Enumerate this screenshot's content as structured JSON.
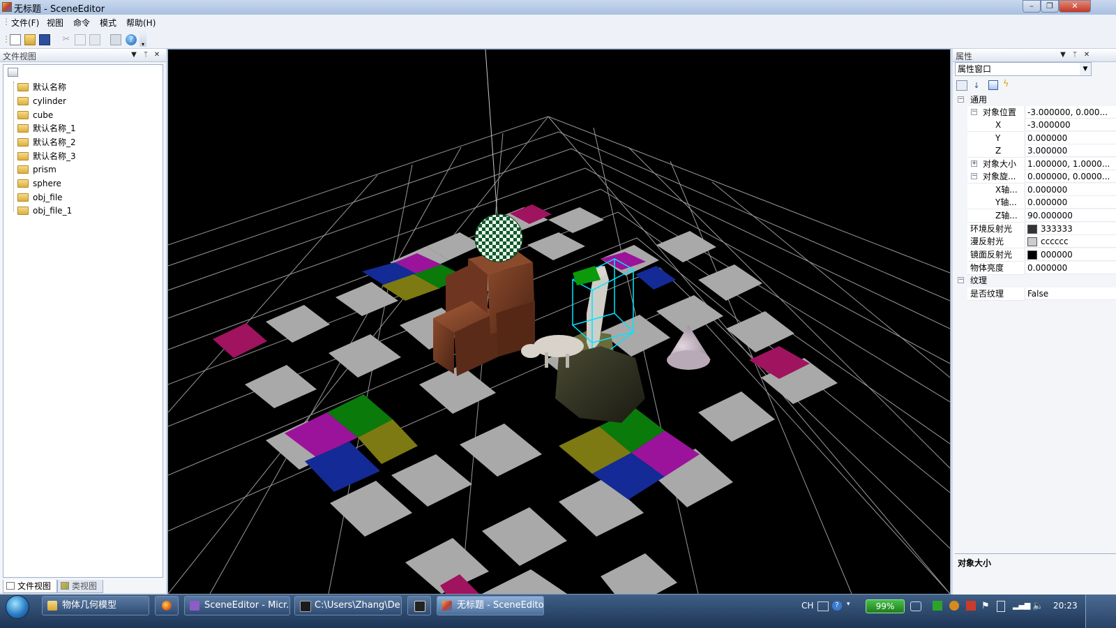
{
  "window": {
    "title": "无标题 - SceneEditor",
    "controls": [
      "minimize",
      "maximize",
      "close"
    ]
  },
  "menu": [
    "文件(F)",
    "视图",
    "命令",
    "模式",
    "帮助(H)"
  ],
  "toolbar_icons": [
    "new-icon",
    "open-icon",
    "save-icon",
    "cut-icon",
    "copy-icon",
    "paste-icon",
    "print-icon",
    "help-icon"
  ],
  "file_view": {
    "title": "文件视图",
    "items": [
      "默认名称",
      "cylinder",
      "cube",
      "默认名称_1",
      "默认名称_2",
      "默认名称_3",
      "prism",
      "sphere",
      "obj_file",
      "obj_file_1"
    ],
    "tabs": [
      "文件视图",
      "类视图"
    ]
  },
  "properties": {
    "title": "属性",
    "selector": "属性窗口",
    "sections": {
      "general": "通用",
      "texture": "纹理"
    },
    "rows": {
      "position": {
        "name": "对象位置",
        "value": "-3.000000, 0.000..."
      },
      "pos_x": {
        "name": "X",
        "value": "-3.000000"
      },
      "pos_y": {
        "name": "Y",
        "value": "0.000000"
      },
      "pos_z": {
        "name": "Z",
        "value": "3.000000"
      },
      "size": {
        "name": "对象大小",
        "value": "1.000000, 1.0000..."
      },
      "rotation": {
        "name": "对象旋...",
        "value": "0.000000, 0.0000..."
      },
      "rot_x": {
        "name": "X轴...",
        "value": "0.000000"
      },
      "rot_y": {
        "name": "Y轴...",
        "value": "0.000000"
      },
      "rot_z": {
        "name": "Z轴...",
        "value": "90.000000"
      },
      "ambient": {
        "name": "环境反射光",
        "value": "333333",
        "color": "#333333"
      },
      "diffuse": {
        "name": "漫反射光",
        "value": "cccccc",
        "color": "#cccccc"
      },
      "specular": {
        "name": "镜面反射光",
        "value": "000000",
        "color": "#000000"
      },
      "shininess": {
        "name": "物体亮度",
        "value": "0.000000"
      },
      "has_texture": {
        "name": "是否纹理",
        "value": "False"
      }
    },
    "description": "对象大小"
  },
  "taskbar": {
    "buttons": [
      "物体几何模型",
      "SceneEditor - Micr...",
      "C:\\Users\\Zhang\\De...",
      "无标题 - SceneEditor"
    ],
    "tray": {
      "ime": "CH",
      "battery": "99%",
      "time": "20:23"
    }
  }
}
